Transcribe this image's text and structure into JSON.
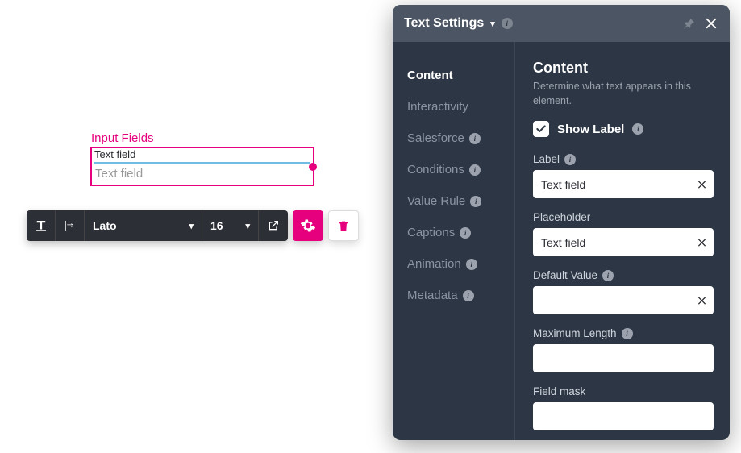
{
  "canvas": {
    "widget_title": "Input Fields",
    "widget_label": "Text field",
    "widget_placeholder": "Text field"
  },
  "toolbar": {
    "font": "Lato",
    "font_size": "16"
  },
  "panel": {
    "title": "Text Settings",
    "nav": {
      "items": [
        {
          "label": "Content",
          "active": true,
          "info": false
        },
        {
          "label": "Interactivity",
          "active": false,
          "info": false
        },
        {
          "label": "Salesforce",
          "active": false,
          "info": true
        },
        {
          "label": "Conditions",
          "active": false,
          "info": true
        },
        {
          "label": "Value Rule",
          "active": false,
          "info": true
        },
        {
          "label": "Captions",
          "active": false,
          "info": true
        },
        {
          "label": "Animation",
          "active": false,
          "info": true
        },
        {
          "label": "Metadata",
          "active": false,
          "info": true
        }
      ]
    },
    "content": {
      "heading": "Content",
      "description": "Determine what text appears in this element.",
      "show_label_text": "Show Label",
      "show_label_checked": true,
      "fields": {
        "label": {
          "name": "Label",
          "value": "Text field",
          "clear": true,
          "info": true
        },
        "placeholder": {
          "name": "Placeholder",
          "value": "Text field",
          "clear": true,
          "info": false
        },
        "default_value": {
          "name": "Default Value",
          "value": "",
          "clear": true,
          "info": true
        },
        "maximum_length": {
          "name": "Maximum Length",
          "value": "",
          "clear": false,
          "info": true
        },
        "field_mask": {
          "name": "Field mask",
          "value": "",
          "clear": false,
          "info": false
        }
      }
    }
  }
}
